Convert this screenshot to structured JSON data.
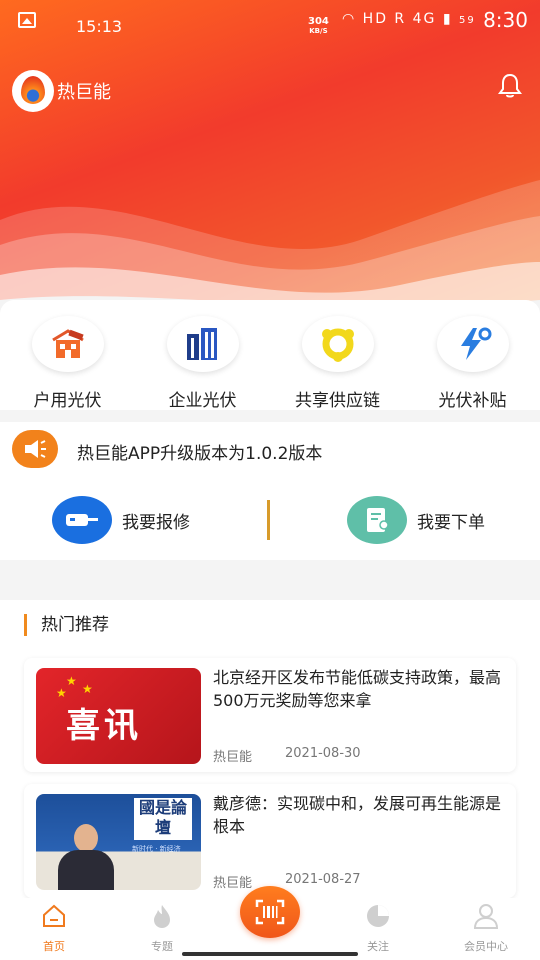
{
  "status_bar": {
    "time_left": "15:13",
    "net_speed_value": "304",
    "net_speed_unit": "KB/S",
    "icons_text": "HD R 4G",
    "battery": "59",
    "clock": "8:30"
  },
  "app_bar": {
    "title": "热巨能"
  },
  "quick_nav": [
    {
      "label": "户用光伏",
      "icon": "house-solar-icon"
    },
    {
      "label": "企业光伏",
      "icon": "building-icon"
    },
    {
      "label": "共享供应链",
      "icon": "share-chain-icon"
    },
    {
      "label": "光伏补贴",
      "icon": "bolt-gear-icon"
    }
  ],
  "notice": {
    "text": "热巨能APP升级版本为1.0.2版本",
    "icon": "speaker-icon"
  },
  "actions": {
    "repair_label": "我要报修",
    "order_label": "我要下单"
  },
  "hot": {
    "title": "热门推荐",
    "articles": [
      {
        "thumb_text": "喜讯",
        "title": "北京经开区发布节能低碳支持政策，最高500万元奖励等您来拿",
        "source": "热巨能",
        "date": "2021-08-30"
      },
      {
        "thumb_text": "國是論壇",
        "thumb_caption": "新时代 · 新经济",
        "title": "戴彦德：实现碳中和，发展可再生能源是根本",
        "source": "热巨能",
        "date": "2021-08-27"
      }
    ]
  },
  "bottom_nav": [
    {
      "label": "首页",
      "icon": "home-icon",
      "active": true
    },
    {
      "label": "专题",
      "icon": "flame-icon"
    },
    {
      "label": "扫码",
      "icon": "scan-icon"
    },
    {
      "label": "关注",
      "icon": "pie-icon"
    },
    {
      "label": "会员中心",
      "icon": "user-icon"
    }
  ],
  "colors": {
    "accent": "#f07a1e",
    "hero_red": "#f23b2c",
    "blue": "#1a6fe0",
    "teal": "#5fbfa8"
  }
}
